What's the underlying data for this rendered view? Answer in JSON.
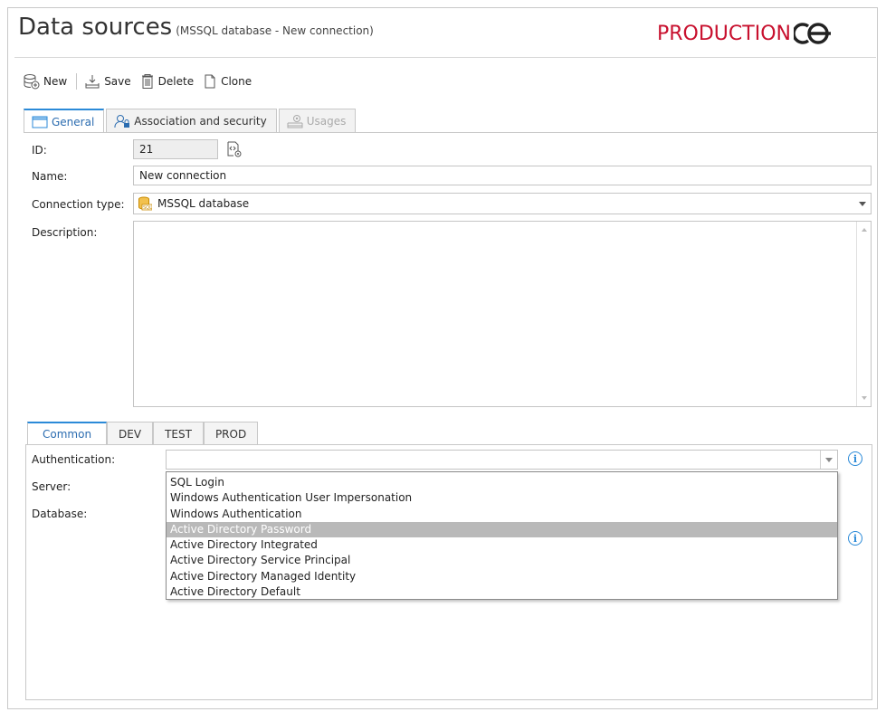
{
  "header": {
    "title": "Data sources",
    "subtitle": "(MSSQL database - New connection)",
    "logo_text": "PRODUCTION",
    "logo_color": "#c8102e"
  },
  "toolbar": {
    "new_label": "New",
    "save_label": "Save",
    "delete_label": "Delete",
    "clone_label": "Clone"
  },
  "tabs": {
    "general": "General",
    "association": "Association and security",
    "usages": "Usages"
  },
  "form": {
    "id_label": "ID:",
    "id_value": "21",
    "name_label": "Name:",
    "name_value": "New connection",
    "conn_type_label": "Connection type:",
    "conn_type_value": "MSSQL database",
    "description_label": "Description:",
    "description_value": ""
  },
  "env_tabs": {
    "common": "Common",
    "dev": "DEV",
    "test": "TEST",
    "prod": "PROD"
  },
  "env_form": {
    "auth_label": "Authentication:",
    "auth_value": "",
    "server_label": "Server:",
    "database_label": "Database:"
  },
  "auth_options": [
    "SQL Login",
    "Windows Authentication User Impersonation",
    "Windows Authentication",
    "Active Directory Password",
    "Active Directory Integrated",
    "Active Directory Service Principal",
    "Active Directory Managed Identity",
    "Active Directory Default"
  ],
  "auth_highlighted": "Active Directory Password",
  "colors": {
    "accent": "#2b8ad8",
    "highlight": "#b9b9b9"
  }
}
